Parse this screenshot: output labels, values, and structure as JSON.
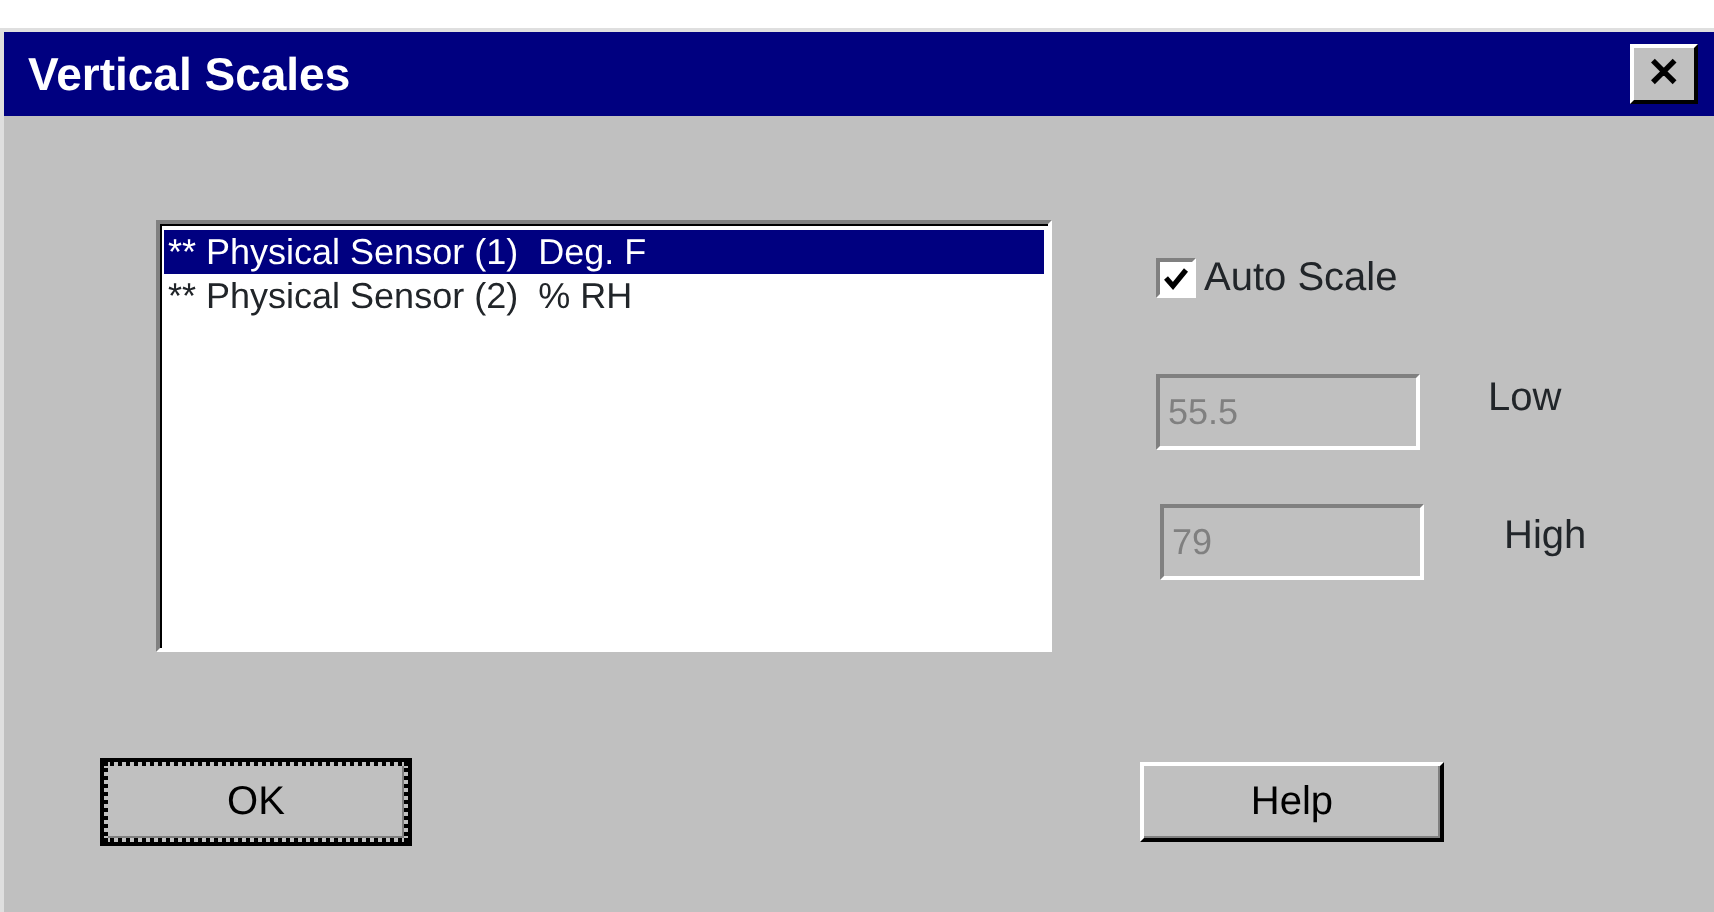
{
  "window": {
    "title": "Vertical Scales",
    "close": "✕"
  },
  "list": {
    "items": [
      {
        "label": "** Physical Sensor (1)  Deg. F",
        "selected": true
      },
      {
        "label": "** Physical Sensor (2)  % RH",
        "selected": false
      }
    ]
  },
  "auto_scale": {
    "label": "Auto Scale",
    "checked": true
  },
  "fields": [
    {
      "label": "Low",
      "value": "55.5",
      "disabled": true
    },
    {
      "label": "High",
      "value": "79",
      "disabled": true
    }
  ],
  "buttons": [
    {
      "label": "OK",
      "focused": true
    },
    {
      "label": "Help",
      "focused": false
    }
  ]
}
